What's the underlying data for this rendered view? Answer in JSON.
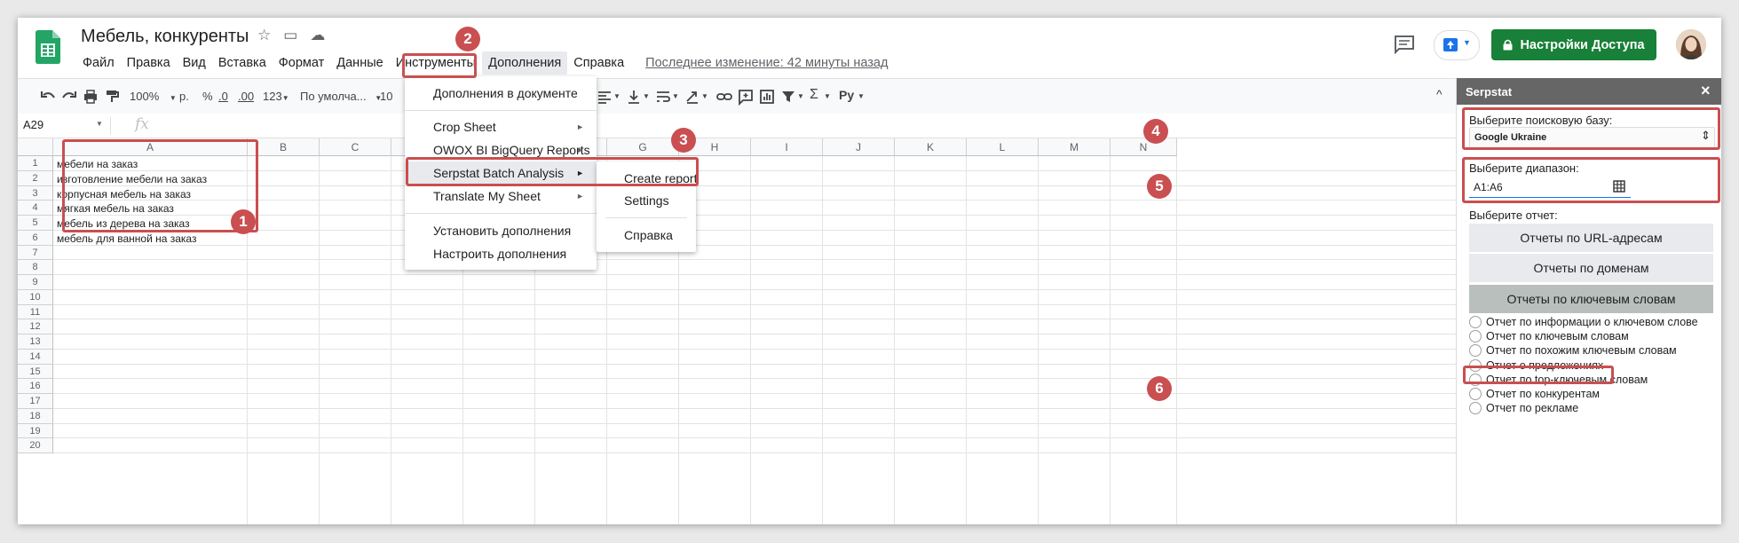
{
  "doc": {
    "title": "Мебель, конкуренты",
    "menu": [
      "Файл",
      "Правка",
      "Вид",
      "Вставка",
      "Формат",
      "Данные",
      "Инструменты",
      "Дополнения",
      "Справка"
    ],
    "last_edit": "Последнее изменение: 42 минуты назад"
  },
  "header": {
    "share_label": "Настройки Доступа"
  },
  "toolbar": {
    "zoom": "100%",
    "currency": "р.",
    "percent": "%",
    "dec_less": ".0",
    "dec_more": ".00",
    "format_num": "123",
    "font": "По умолча...",
    "font_size": "10",
    "addon_label": "Ру"
  },
  "formula_bar": {
    "name_box": "A29",
    "fx": "fx"
  },
  "grid": {
    "columns": [
      "A",
      "B",
      "C",
      "D",
      "E",
      "F",
      "G",
      "H",
      "I",
      "J",
      "K",
      "L",
      "M",
      "N"
    ],
    "rows": [
      "1",
      "2",
      "3",
      "4",
      "5",
      "6",
      "7",
      "8",
      "9",
      "10",
      "11",
      "12",
      "13",
      "14",
      "15",
      "16",
      "17",
      "18",
      "19",
      "20"
    ],
    "cells_a": [
      "мебели на заказ",
      "изготовление мебели на заказ",
      "корпусная мебель на заказ",
      "мягкая мебель на заказ",
      "мебель из дерева на заказ",
      "мебель для ванной на заказ"
    ]
  },
  "addons_menu": {
    "doc_addons": "Дополнения в документе",
    "items": [
      "Crop Sheet",
      "OWOX BI BigQuery Reports",
      "Serpstat Batch Analysis",
      "Translate My Sheet"
    ],
    "install": "Установить дополнения",
    "manage": "Настроить дополнения"
  },
  "submenu": {
    "items": [
      "Create report",
      "Settings",
      "Справка"
    ]
  },
  "panel": {
    "title": "Serpstat",
    "close": "×",
    "db_label": "Выберите поисковую базу:",
    "db_value": "Google Ukraine",
    "range_label": "Выберите диапазон:",
    "range_value": "A1:A6",
    "report_label": "Выберите отчет:",
    "buttons": [
      "Отчеты по URL-адресам",
      "Отчеты по доменам",
      "Отчеты по ключевым словам"
    ],
    "radios": [
      "Отчет по информации о ключевом слове",
      "Отчет по ключевым словам",
      "Отчет по похожим ключевым словам",
      "Отчет о предложениях",
      "Отчет по top-ключевым словам",
      "Отчет по конкурентам",
      "Отчет по рекламе"
    ]
  },
  "annotations": [
    "1",
    "2",
    "3",
    "4",
    "5",
    "6"
  ],
  "colors": {
    "accent_green": "#188038",
    "annotation_red": "#c94f51",
    "panel_header": "#666666"
  }
}
